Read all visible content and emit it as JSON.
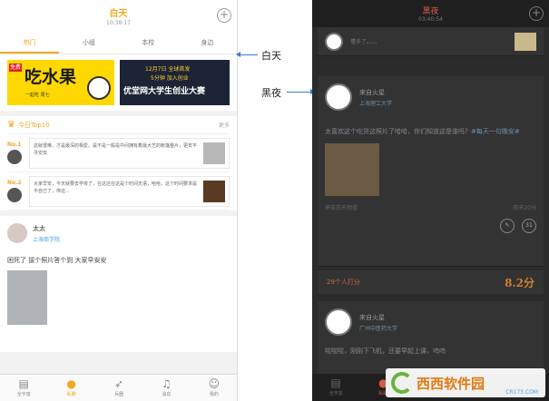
{
  "day": {
    "header": {
      "title": "白天",
      "time": "10:38:17"
    },
    "tabs": [
      {
        "label": "热门"
      },
      {
        "label": "小组"
      },
      {
        "label": "本校"
      },
      {
        "label": "身边"
      }
    ],
    "banner1": {
      "tag": "免费",
      "headline": "吃水果",
      "sub": "一起吃 周七"
    },
    "banner2": {
      "line1": "12月7日 全球首发",
      "line2": "5分钟 加入创业",
      "main": "优堂网大学生创业大赛"
    },
    "top10": {
      "title": "今日Top10",
      "more": "更多",
      "items": [
        {
          "rank": "No.1",
          "text": "这就很难，才是最深的相爱。是不是一般是中间拥有着最大艺的帐篷整片，更安平寻安安"
        },
        {
          "rank": "No.2",
          "text": "大家早安，今天就要去学校了，在这还在这是个时间无语，哈哈，这个时间要求是不自己了，停这..."
        }
      ]
    },
    "post": {
      "name": "太太",
      "school": "上海商学院",
      "text": "困死了 拔个照片答个到 大家早安安"
    },
    "nav": [
      {
        "label": "全宇宙",
        "icon": "message-icon"
      },
      {
        "label": "私聊",
        "icon": "chat-icon"
      },
      {
        "label": "兵器",
        "icon": "rocket-icon"
      },
      {
        "label": "消息",
        "icon": "bell-icon"
      },
      {
        "label": "我的",
        "icon": "user-icon"
      }
    ]
  },
  "labels": {
    "day": "白天",
    "night": "黑夜"
  },
  "night": {
    "header": {
      "title": "黑夜",
      "time": "03:40:54"
    },
    "card0": {
      "text": "懂多了。。。。"
    },
    "card1": {
      "name": "来自火星",
      "school": "上海理工大学",
      "text": "太喜欢这个吃货这照片了哈哈，你们知道这是谁吗？",
      "link": "#每天一句晚安#",
      "source": "来自白天频道",
      "time": "昨天20分",
      "comments": "31"
    },
    "foot": {
      "likes": "29个人打分",
      "score": "8.2分"
    },
    "card2": {
      "name": "来自火星",
      "school": "广州中医药大学",
      "text": "啦啦啦，刚刚下飞机，还要早起上课，呜呜"
    },
    "nav": [
      {
        "label": "全宇宙",
        "icon": "message-icon"
      },
      {
        "label": "私聊",
        "icon": "chat-icon"
      }
    ]
  },
  "watermark": {
    "brand": "西西软件园",
    "url": "CR173.COM"
  }
}
